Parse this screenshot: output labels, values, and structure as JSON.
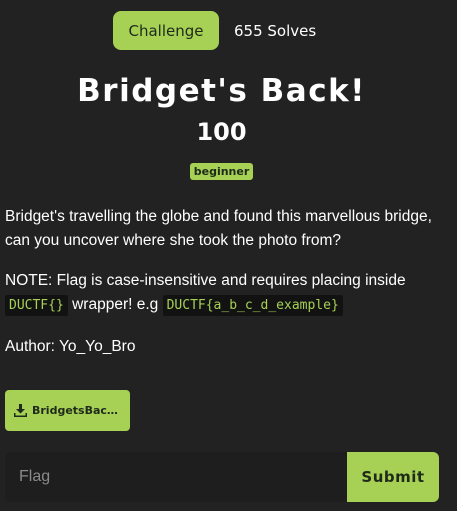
{
  "tabs": {
    "challenge_label": "Challenge",
    "solves_label": "655 Solves"
  },
  "challenge": {
    "title": "Bridget's Back!",
    "points": "100",
    "tag": "beginner",
    "description_line1": "Bridget's travelling the globe and found this marvellous bridge, can you uncover where she took the photo from?",
    "note_prefix": "NOTE: Flag is case-insensitive and requires placing inside",
    "note_code1": "DUCTF{}",
    "note_middle": "wrapper! e.g",
    "note_code2": "DUCTF{a_b_c_d_example}",
    "author": "Author: Yo_Yo_Bro"
  },
  "file": {
    "label": "BridgetsBac…",
    "icon": "download-icon"
  },
  "form": {
    "flag_placeholder": "Flag",
    "flag_value": "",
    "submit_label": "Submit"
  },
  "colors": {
    "accent": "#a6d155",
    "background": "#222222"
  }
}
